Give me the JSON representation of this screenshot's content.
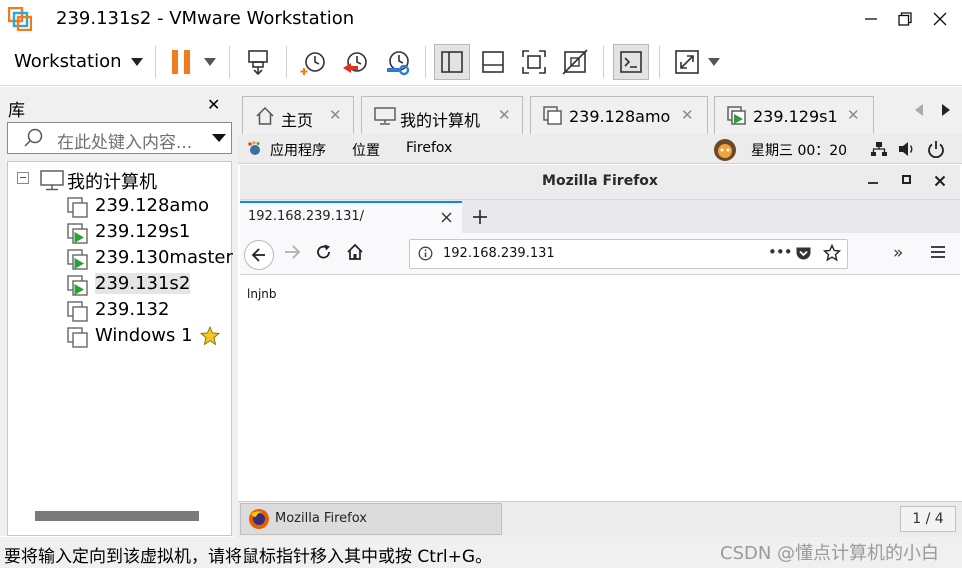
{
  "window": {
    "title": "239.131s2 - VMware Workstation",
    "minimize_glyph": "—",
    "maximize_glyph": "❐",
    "close_glyph": "✕"
  },
  "toolbar": {
    "workstation_menu": "Workstation",
    "buttons": [
      "pause-icon",
      "send-keys-icon",
      "snapshot-icon",
      "revert-snapshot-icon",
      "snapshot-manager-icon",
      "library-view-icon",
      "thumbnail-view-icon",
      "fullscreen-icon",
      "unity-icon",
      "console-icon",
      "stretch-icon"
    ],
    "pause_color": "#f07c1b"
  },
  "library": {
    "title": "库",
    "close_glyph": "✕",
    "search_placeholder": "在此处键入内容...",
    "root_label": "我的计算机",
    "items": [
      {
        "label": "239.128amo",
        "running": false,
        "selected": false
      },
      {
        "label": "239.129s1",
        "running": true,
        "selected": false
      },
      {
        "label": "239.130master",
        "running": true,
        "selected": false
      },
      {
        "label": "239.131s2",
        "running": true,
        "selected": true
      },
      {
        "label": "239.132",
        "running": false,
        "selected": false
      },
      {
        "label": "Windows 1",
        "running": false,
        "selected": false,
        "favorite": true
      }
    ]
  },
  "vm_tabs": {
    "items": [
      {
        "label": "主页",
        "icon": "home-icon"
      },
      {
        "label": "我的计算机",
        "icon": "computer-icon"
      },
      {
        "label": "239.128amo",
        "icon": "vm-icon"
      },
      {
        "label": "239.129s1",
        "icon": "vm-running-icon"
      }
    ],
    "close_glyph": "✕"
  },
  "guest": {
    "menus": [
      "应用程序",
      "位置",
      "Firefox"
    ],
    "clock": "星期三 00：20",
    "firefox": {
      "window_title": "Mozilla Firefox",
      "tab_title": "192.168.239.131/",
      "url": "192.168.239.131",
      "page_text": "lnjnb",
      "more_glyph": "•••",
      "overflow_glyph": "»"
    },
    "taskbar": {
      "item_label": "Mozilla Firefox",
      "pager": "1 / 4"
    }
  },
  "statusbar": {
    "message": "要将输入定向到该虚拟机，请将鼠标指针移入其中或按 Ctrl+G。",
    "watermark": "CSDN @懂点计算机的小白"
  },
  "colors": {
    "accent_blue": "#0a84ff",
    "vm_green": "#2e9e3a",
    "vmware_orange": "#f07c1b"
  }
}
